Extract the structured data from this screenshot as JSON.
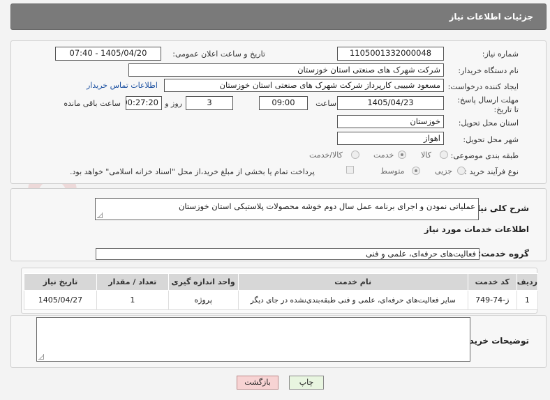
{
  "header": {
    "title": "جزئیات اطلاعات نیاز"
  },
  "watermark": {
    "text": "AriaTender.net"
  },
  "form": {
    "need_number_label": "شماره نیاز:",
    "need_number": "1105001332000048",
    "announce_label": "تاریخ و ساعت اعلان عمومی:",
    "announce_value": "1405/04/20 - 07:40",
    "buyer_org_label": "نام دستگاه خریدار:",
    "buyer_org": "شرکت شهرک های صنعتی استان خوزستان",
    "requester_label": "ایجاد کننده درخواست:",
    "requester": "مسعود شبیبی کارپرداز شرکت شهرک های صنعتی استان خوزستان",
    "contact_link": "اطلاعات تماس خریدار",
    "deadline_label": "مهلت ارسال پاسخ: تا تاریخ:",
    "deadline_date": "1405/04/23",
    "time_label": "ساعت",
    "deadline_time": "09:00",
    "days_value": "3",
    "days_label": "روز و",
    "remaining_time": "00:27:20",
    "remaining_label": "ساعت باقی مانده",
    "province_label": "استان محل تحویل:",
    "province": "خوزستان",
    "city_label": "شهر محل تحویل:",
    "city": "اهواز",
    "category_label": "طبقه بندی موضوعی:",
    "category_options": [
      "کالا",
      "خدمت",
      "کالا/خدمت"
    ],
    "category_selected": "خدمت",
    "process_label": "نوع فرآیند خرید :",
    "process_options": [
      "جزیی",
      "متوسط"
    ],
    "process_selected": "متوسط",
    "payment_note": "پرداخت تمام یا بخشی از مبلغ خرید،از محل \"اسناد خزانه اسلامی\" خواهد بود."
  },
  "description": {
    "label": "شرح کلی نیاز:",
    "text": "عملیاتی نمودن و اجرای برنامه عمل سال دوم خوشه محصولات پلاستیکی استان خوزستان"
  },
  "services": {
    "section_title": "اطلاعات خدمات مورد نیاز",
    "group_label": "گروه خدمت:",
    "group_value": "فعالیت‌های حرفه‌ای، علمی و فنی",
    "columns": [
      "ردیف",
      "کد خدمت",
      "نام خدمت",
      "واحد اندازه گیری",
      "تعداد / مقدار",
      "تاریخ نیاز"
    ],
    "rows": [
      {
        "index": "1",
        "code": "ز-74-749",
        "name": "سایر فعالیت‌های حرفه‌ای، علمی و فنی طبقه‌بندی‌نشده در جای دیگر",
        "unit": "پروژه",
        "qty": "1",
        "date": "1405/04/27"
      }
    ]
  },
  "buyer_notes": {
    "label": "توضیحات خریدار:",
    "value": ""
  },
  "actions": {
    "print_label": "چاپ",
    "back_label": "بازگشت"
  }
}
